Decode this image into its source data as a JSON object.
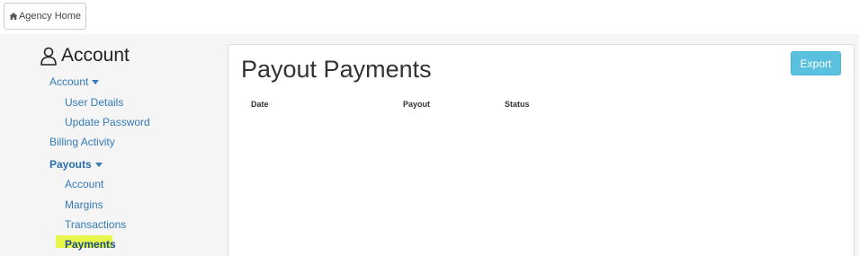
{
  "topbar": {
    "agency_home_label": "Agency Home"
  },
  "sidebar": {
    "title": "Account",
    "account_menu_label": "Account",
    "user_details": "User Details",
    "update_password": "Update Password",
    "billing_activity": "Billing Activity",
    "payouts_menu_label": "Payouts",
    "payouts_items": [
      "Account",
      "Margins",
      "Transactions",
      "Payments"
    ]
  },
  "main": {
    "title": "Payout Payments",
    "export_label": "Export",
    "columns": [
      "Date",
      "Payout",
      "Status"
    ]
  },
  "colors": {
    "link": "#337ab7",
    "export_button": "#5bc0de",
    "highlight": "#e8f54a"
  }
}
